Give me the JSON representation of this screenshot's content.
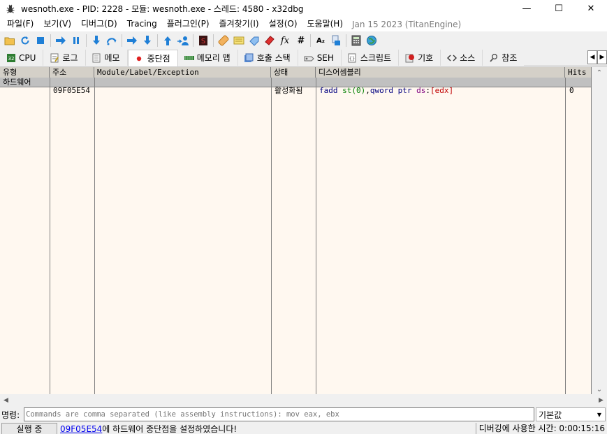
{
  "window": {
    "title": "wesnoth.exe - PID: 2228 - 모듈: wesnoth.exe - 스레드: 4580 - x32dbg",
    "app_icon": "bug-icon",
    "controls": {
      "minimize": "—",
      "maximize": "☐",
      "close": "✕"
    }
  },
  "menu": {
    "items": [
      "파일(F)",
      "보기(V)",
      "디버그(D)",
      "Tracing",
      "플러그인(P)",
      "즐겨찾기(I)",
      "설정(O)",
      "도움말(H)"
    ],
    "build_info": "Jan 15 2023 (TitanEngine)"
  },
  "toolbar": {
    "buttons": [
      "open-icon",
      "restart-icon",
      "stop-icon",
      "run-icon",
      "pause-icon",
      "step-into-icon",
      "step-over-icon",
      "trace-into-icon",
      "trace-over-icon",
      "execute-till-return-icon",
      "run-to-user-code-icon",
      "scylla-icon",
      "patch-icon",
      "comment-icon",
      "label-icon",
      "bookmark-icon",
      "function-icon",
      "hash-icon",
      "font-icon",
      "attach-icon",
      "calculator-icon",
      "globe-icon"
    ],
    "function_glyph": "fx",
    "hash_glyph": "#",
    "font_glyph": "A₂"
  },
  "tabs": [
    {
      "label": "CPU",
      "icon": "cpu-icon"
    },
    {
      "label": "로그",
      "icon": "log-icon"
    },
    {
      "label": "메모",
      "icon": "notes-icon"
    },
    {
      "label": "중단점",
      "icon": "breakpoint-icon"
    },
    {
      "label": "메모리 맵",
      "icon": "memory-map-icon"
    },
    {
      "label": "호출 스택",
      "icon": "call-stack-icon"
    },
    {
      "label": "SEH",
      "icon": "seh-icon"
    },
    {
      "label": "스크립트",
      "icon": "script-icon"
    },
    {
      "label": "기호",
      "icon": "symbols-icon"
    },
    {
      "label": "소스",
      "icon": "source-icon"
    },
    {
      "label": "참조",
      "icon": "references-icon"
    }
  ],
  "active_tab": "중단점",
  "table": {
    "columns": [
      "유형",
      "주소",
      "Module/Label/Exception",
      "상태",
      "디스어셈블리",
      "Hits"
    ],
    "group_label": "하드웨어",
    "rows": [
      {
        "address": "09F05E54",
        "module": "",
        "state": "활성화됨",
        "disasm": {
          "mnemonic": "fadd",
          "op1": "st(0)",
          "comma": ",",
          "size": "qword",
          "ptr": "ptr",
          "seg": "ds",
          "colon": ":",
          "lbr": "[",
          "reg": "edx",
          "rbr": "]"
        },
        "hits": "0"
      }
    ]
  },
  "command": {
    "label": "명령:",
    "placeholder": "Commands are comma separated (like assembly instructions): mov eax, ebx",
    "mode": "기본값"
  },
  "status": {
    "state": "실행 중",
    "link": "09F05E54",
    "message": "에 하드웨어 중단점을 설정하였습니다!",
    "time": "디버깅에 사용한 시간: 0:00:15:16"
  },
  "colors": {
    "table_bg": "#fff8f0",
    "header_bg": "#d4d0c8",
    "mnemonic": "#000080",
    "register": "#008000",
    "segment": "#800080",
    "bracket": "#c00000",
    "link": "#0000ee"
  }
}
